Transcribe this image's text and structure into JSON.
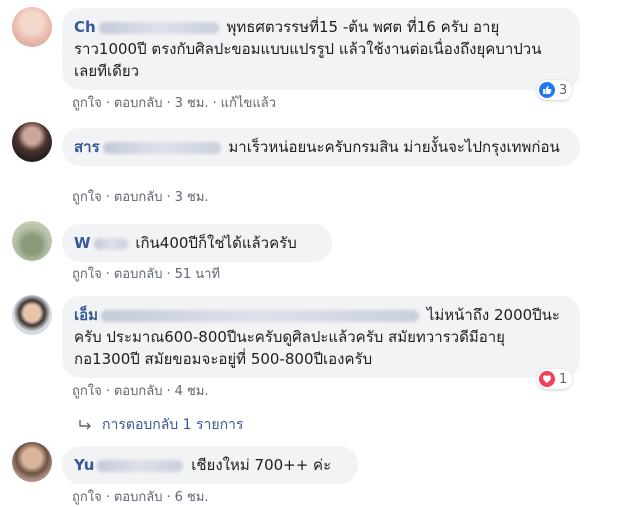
{
  "comments": [
    {
      "author_visible": "Ch",
      "text": "พุทธศตวรรษที่15 -ต้น พศต ที่16 ครับ อายุราว1000ปี ตรงกับศิลปะขอมแบบแปรรูป แล้วใช้งานต่อเนื่องถึงยุคบาปวน เลยทีเดียว",
      "like": "ถูกใจ",
      "reply": "ตอบกลับ",
      "time": "3 ชม.",
      "edited": "แก้ไขแล้ว",
      "reaction_count": "3",
      "reaction_color": "#2078f4"
    },
    {
      "author_visible": "สาร",
      "text": "มาเร็วหน่อยนะครับกรมสิน ม่ายงั้นจะไปกรุงเทพก่อน",
      "like": "ถูกใจ",
      "reply": "ตอบกลับ",
      "time": "3 ชม."
    },
    {
      "author_visible": "W",
      "text": "เกิน400ปีก็ใช่ได้แล้วครับ",
      "like": "ถูกใจ",
      "reply": "ตอบกลับ",
      "time": "51 นาที"
    },
    {
      "author_visible": "เอ็ม",
      "text": "ไม่หน้าถึง 2000ปีนะครับ ประมาณ600-800ปีนะครับดูศิลปะแล้วครับ สมัยทวารวดีมีอายุกอ1300ปี สมัยขอมจะอยู่ที่ 500-800ปีเองครับ",
      "like": "ถูกใจ",
      "reply": "ตอบกลับ",
      "time": "4 ชม.",
      "reaction_count": "1",
      "reaction_color": "#f33e58"
    },
    {
      "author_visible": "Yu",
      "text": "เชียงใหม่ 700++ ค่ะ",
      "like": "ถูกใจ",
      "reply": "ตอบกลับ",
      "time": "6 ชม."
    }
  ],
  "replies_link": "การตอบกลับ 1 รายการ"
}
